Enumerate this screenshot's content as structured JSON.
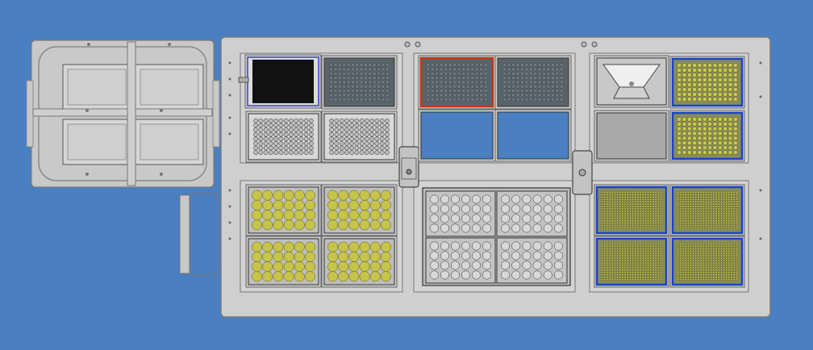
{
  "scene": {
    "background_color": "#4a7fc1",
    "deck_color": "#cfcfcf",
    "deck_edge_color": "#7d7d7d",
    "empty_slot_color": "#4a7fc1",
    "dark_plate_color": "#59636a",
    "highlight_plate_border": "#c8361a",
    "tip_rack_border": "#1a44c8",
    "tip_color": "#c8c850",
    "reservoir_color": "#111111"
  },
  "left_module": {
    "label": "",
    "wells": 4
  },
  "deck": {
    "regions": [
      {
        "name": "upper-left",
        "slots": [
          "reservoir-black",
          "plate-dark-96",
          "plate-grid-96",
          "plate-grid-96"
        ]
      },
      {
        "name": "upper-middle",
        "slots": [
          "plate-dark-96-highlighted",
          "plate-dark-96",
          "empty",
          "empty"
        ]
      },
      {
        "name": "upper-right",
        "slots": [
          "trough-funnel",
          "tip-rack",
          "trough-grey",
          "tip-rack"
        ]
      },
      {
        "name": "lower-left",
        "slots": [
          "tube-rack-24",
          "tube-rack-24",
          "tube-rack-24",
          "tube-rack-24"
        ]
      },
      {
        "name": "lower-middle",
        "slots": [
          "tube-rack-32",
          "tube-rack-32",
          "tube-rack-32",
          "tube-rack-32"
        ]
      },
      {
        "name": "lower-right",
        "slots": [
          "tip-rack-384",
          "tip-rack-384",
          "tip-rack-384",
          "tip-rack-384"
        ]
      }
    ]
  }
}
